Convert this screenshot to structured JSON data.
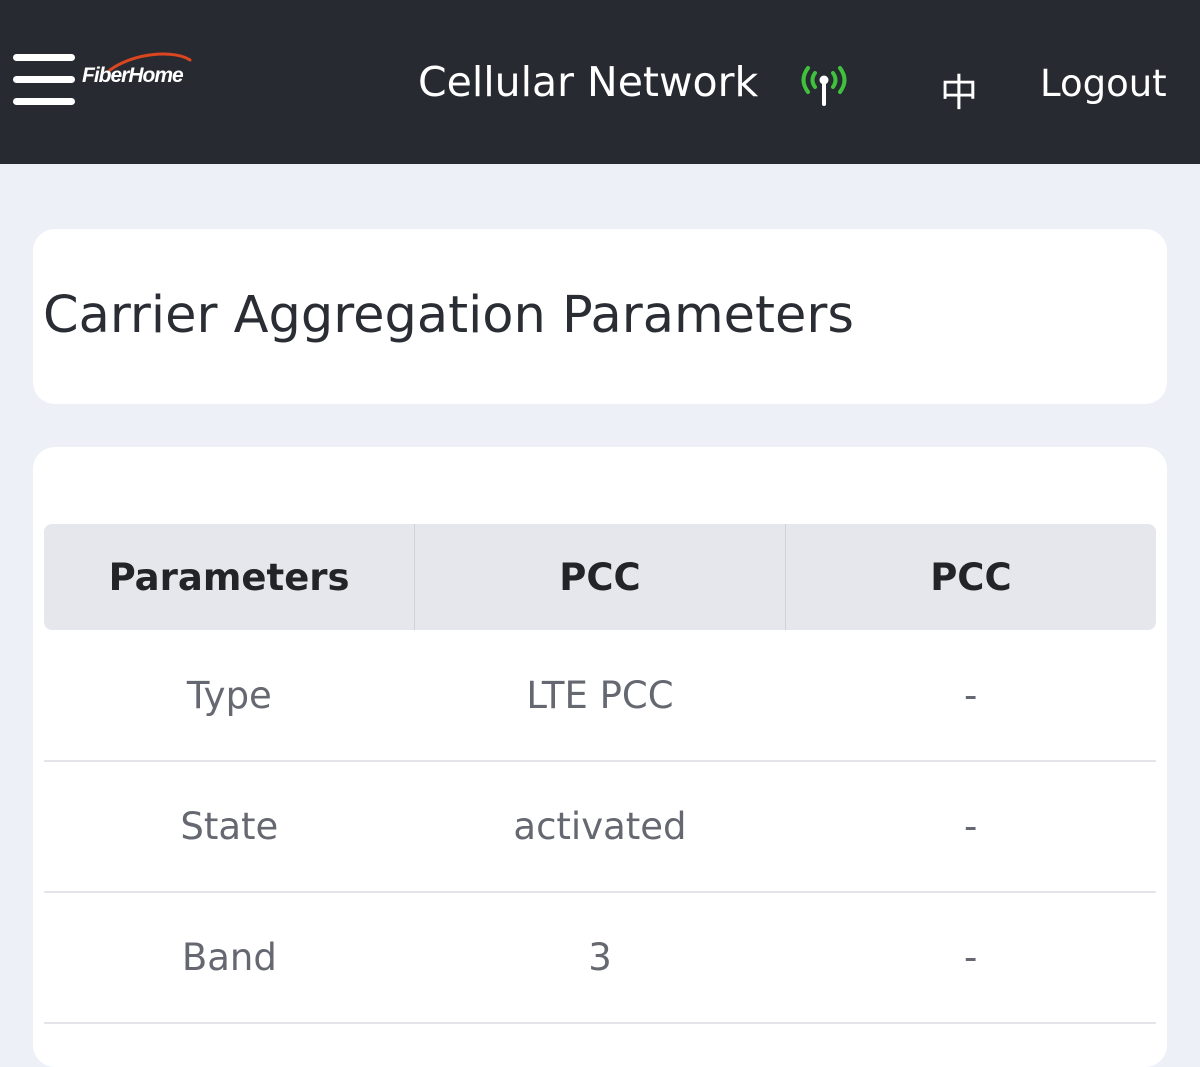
{
  "header": {
    "logo_text": "FiberHome",
    "title": "Cellular Network",
    "language_label": "中",
    "logout_label": "Logout"
  },
  "section": {
    "title": "Carrier Aggregation Parameters"
  },
  "table": {
    "columns": [
      "Parameters",
      "PCC",
      "PCC"
    ],
    "rows": [
      [
        "Type",
        "LTE PCC",
        "-"
      ],
      [
        "State",
        "activated",
        "-"
      ],
      [
        "Band",
        "3",
        "-"
      ]
    ]
  },
  "icons": {
    "menu": "hamburger-menu-icon",
    "signal": "signal-antenna-icon"
  },
  "colors": {
    "header_background": "#272a30",
    "page_background": "#eef0f7",
    "signal_green": "#3fc23c",
    "logo_orange": "#d9461f"
  }
}
